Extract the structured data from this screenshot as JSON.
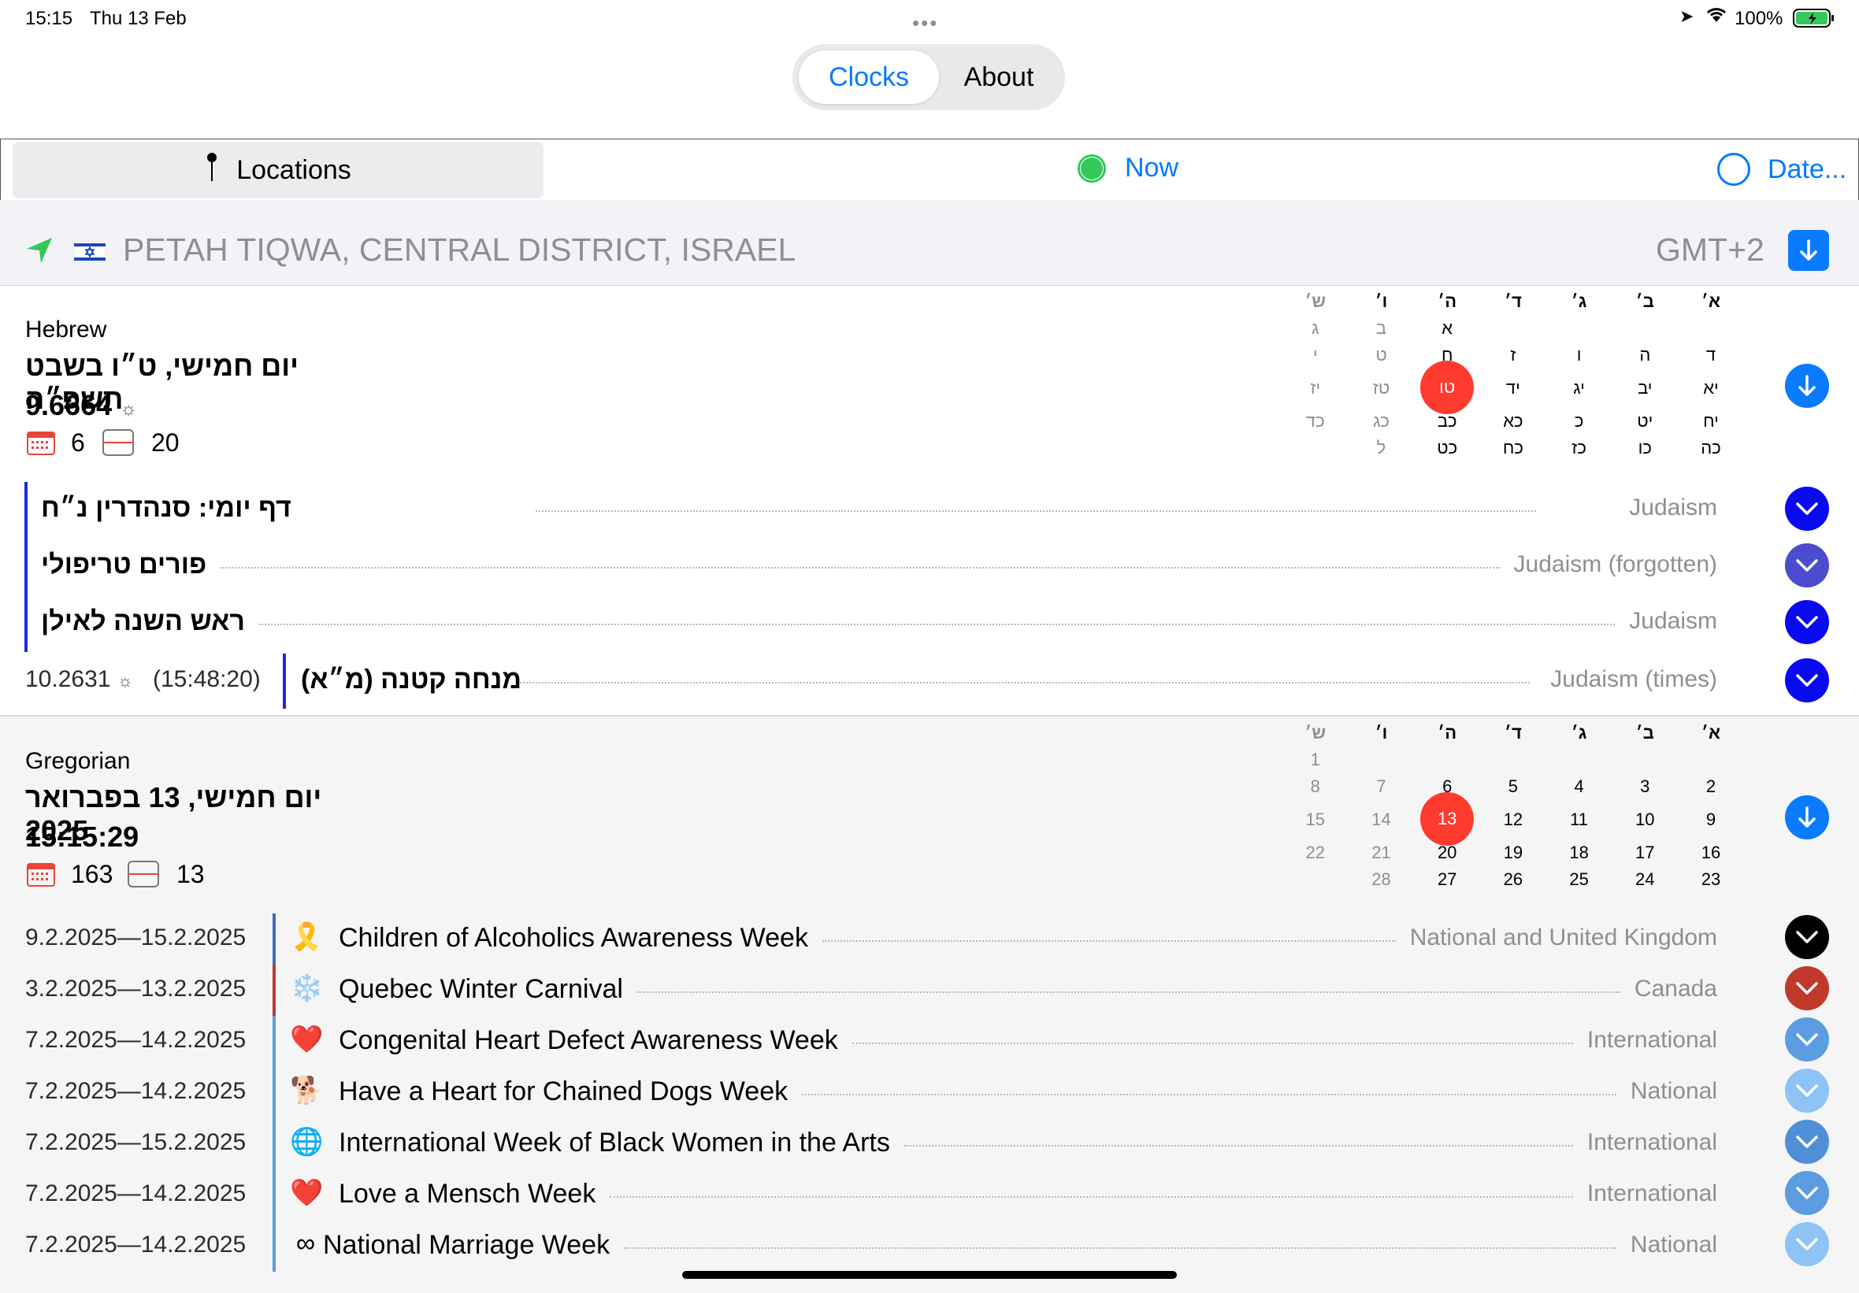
{
  "status_bar": {
    "time": "15:15",
    "date": "Thu 13 Feb",
    "battery": "100%"
  },
  "segmented": {
    "active": "Clocks",
    "other": "About"
  },
  "toolbar": {
    "locations": "Locations",
    "now": "Now",
    "date": "Date..."
  },
  "location": {
    "name": "PETAH TIQWA, CENTRAL DISTRICT, ISRAEL",
    "tz": "GMT+2"
  },
  "hebrew": {
    "label": "Hebrew",
    "date_text": "יום חמישי, ט״ו בשבט תשפ״ה",
    "value": "9.6664",
    "cal_count": "6",
    "week_count": "20",
    "weekdays": [
      "א׳",
      "ב׳",
      "ג׳",
      "ד׳",
      "ה׳",
      "ו׳",
      "ש׳"
    ],
    "weeks": [
      [
        "",
        "",
        "",
        "",
        "א",
        "ב",
        "ג"
      ],
      [
        "ד",
        "ה",
        "ו",
        "ז",
        "ח",
        "ט",
        "י"
      ],
      [
        "יא",
        "יב",
        "יג",
        "יד",
        "טו",
        "טז",
        "יז"
      ],
      [
        "יח",
        "יט",
        "כ",
        "כא",
        "כב",
        "כג",
        "כד"
      ],
      [
        "כה",
        "כו",
        "כז",
        "כח",
        "כט",
        "ל",
        ""
      ]
    ],
    "today": "טו",
    "events": [
      {
        "title": "דף יומי:  סנהדרין נ״ח",
        "category": "Judaism"
      },
      {
        "title": "פורים טריפולי",
        "category": "Judaism (forgotten)"
      },
      {
        "title": "ראש השנה לאילן",
        "category": "Judaism"
      }
    ],
    "time_event": {
      "value": "10.2631",
      "clock": "(15:48:20)",
      "title": "מנחה קטנה (מ״א)",
      "category": "Judaism (times)"
    }
  },
  "gregorian": {
    "label": "Gregorian",
    "date_text": "יום חמישי, 13 בפברואר 2025",
    "time": "15:15:29",
    "cal_count": "163",
    "week_count": "13",
    "weekdays": [
      "א׳",
      "ב׳",
      "ג׳",
      "ד׳",
      "ה׳",
      "ו׳",
      "ש׳"
    ],
    "weeks": [
      [
        "",
        "",
        "",
        "",
        "",
        "",
        "1"
      ],
      [
        "2",
        "3",
        "4",
        "5",
        "6",
        "7",
        "8"
      ],
      [
        "9",
        "10",
        "11",
        "12",
        "13",
        "14",
        "15"
      ],
      [
        "16",
        "17",
        "18",
        "19",
        "20",
        "21",
        "22"
      ],
      [
        "23",
        "24",
        "25",
        "26",
        "27",
        "28",
        ""
      ]
    ],
    "today": "13",
    "events": [
      {
        "dates": "9.2.2025—15.2.2025",
        "icon": "🎗️",
        "icon_name": "ribbon-icon",
        "title": "Children of Alcoholics Awareness Week",
        "category": "National and United Kingdom",
        "color": "#000000",
        "bar": "#3a6fc4"
      },
      {
        "dates": "3.2.2025—13.2.2025",
        "icon": "❄️",
        "icon_name": "snowflake-icon",
        "title": "Quebec Winter Carnival",
        "category": "Canada",
        "color": "#c0392b",
        "bar": "#c0392b"
      },
      {
        "dates": "7.2.2025—14.2.2025",
        "icon": "❤️",
        "icon_name": "heart-icon",
        "title": "Congenital Heart Defect Awareness Week",
        "category": "International",
        "color": "#5b9de0",
        "bar": "#5b9de0"
      },
      {
        "dates": "7.2.2025—14.2.2025",
        "icon": "🐕",
        "icon_name": "dog-icon",
        "title": "Have a Heart for Chained Dogs Week",
        "category": "National",
        "color": "#8ec3f5",
        "bar": "#5b9de0"
      },
      {
        "dates": "7.2.2025—15.2.2025",
        "icon": "🌐",
        "icon_name": "globe-icon",
        "title": "International Week of Black Women in the Arts",
        "category": "International",
        "color": "#4f8fd8",
        "bar": "#5b9de0"
      },
      {
        "dates": "7.2.2025—14.2.2025",
        "icon": "❤️",
        "icon_name": "heart-icon",
        "title": "Love a Mensch Week",
        "category": "International",
        "color": "#5b9de0",
        "bar": "#5b9de0"
      },
      {
        "dates": "7.2.2025—14.2.2025",
        "icon": "∞",
        "icon_name": "rings-icon",
        "title": "National Marriage Week",
        "category": "National",
        "color": "#8ec3f5",
        "bar": "#5b9de0"
      }
    ]
  }
}
